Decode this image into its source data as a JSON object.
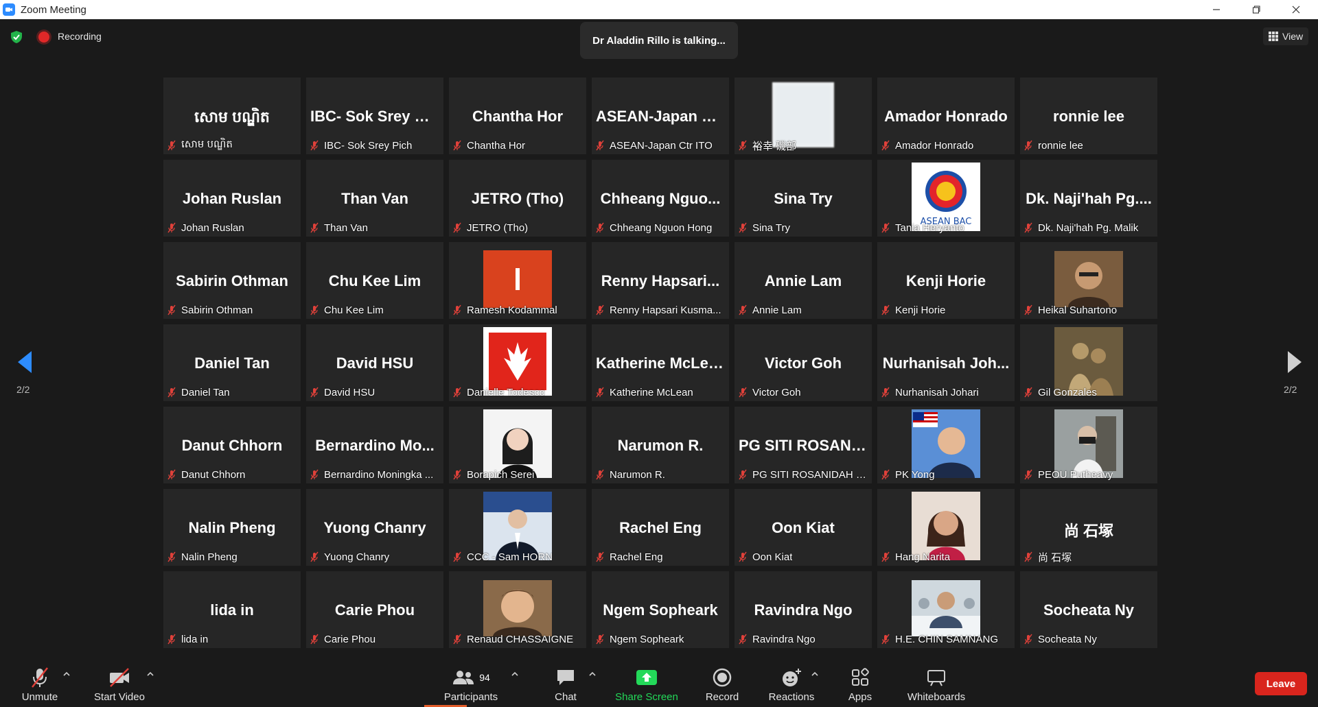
{
  "window": {
    "title": "Zoom Meeting"
  },
  "topbar": {
    "recording_label": "Recording",
    "talking_text": "Dr Aladdin Rillo is talking...",
    "view_label": "View"
  },
  "pager": {
    "left": "2/2",
    "right": "2/2"
  },
  "participants": [
    {
      "big": "សោម បណ្ឌិត",
      "label": "សោម បណ្ឌិត",
      "pic": ""
    },
    {
      "big": "IBC- Sok Srey Pi...",
      "label": "IBC- Sok Srey Pich",
      "pic": ""
    },
    {
      "big": "Chantha Hor",
      "label": "Chantha Hor",
      "pic": ""
    },
    {
      "big": "ASEAN-Japan C...",
      "label": "ASEAN-Japan Ctr ITO",
      "pic": ""
    },
    {
      "big": "",
      "label": "裕幸 磯部",
      "pic": "blur"
    },
    {
      "big": "Amador Honrado",
      "label": "Amador Honrado",
      "pic": ""
    },
    {
      "big": "ronnie lee",
      "label": "ronnie lee",
      "pic": ""
    },
    {
      "big": "Johan Ruslan",
      "label": "Johan Ruslan",
      "pic": ""
    },
    {
      "big": "Than Van",
      "label": "Than Van",
      "pic": ""
    },
    {
      "big": "JETRO (Tho)",
      "label": "JETRO (Tho)",
      "pic": ""
    },
    {
      "big": "Chheang Nguo...",
      "label": "Chheang Nguon Hong",
      "pic": ""
    },
    {
      "big": "Sina Try",
      "label": "Sina Try",
      "pic": ""
    },
    {
      "big": "",
      "label": "Tania Heryanto",
      "pic": "asean"
    },
    {
      "big": "Dk. Naji'hah Pg....",
      "label": "Dk. Naji'hah Pg. Malik",
      "pic": ""
    },
    {
      "big": "Sabirin Othman",
      "label": "Sabirin Othman",
      "pic": ""
    },
    {
      "big": "Chu Kee Lim",
      "label": "Chu Kee Lim",
      "pic": ""
    },
    {
      "big": "",
      "label": "Ramesh Kodammal",
      "pic": "orange"
    },
    {
      "big": "Renny Hapsari...",
      "label": "Renny Hapsari Kusma...",
      "pic": ""
    },
    {
      "big": "Annie Lam",
      "label": "Annie Lam",
      "pic": ""
    },
    {
      "big": "Kenji Horie",
      "label": "Kenji Horie",
      "pic": ""
    },
    {
      "big": "",
      "label": "Heikal Suhartono",
      "pic": "face-brown"
    },
    {
      "big": "Daniel Tan",
      "label": "Daniel Tan",
      "pic": ""
    },
    {
      "big": "David HSU",
      "label": "David HSU",
      "pic": ""
    },
    {
      "big": "",
      "label": "Danielle Todesco",
      "pic": "redlogo"
    },
    {
      "big": "Katherine McLean",
      "label": "Katherine McLean",
      "pic": ""
    },
    {
      "big": "Victor Goh",
      "label": "Victor Goh",
      "pic": ""
    },
    {
      "big": "Nurhanisah Joh...",
      "label": "Nurhanisah Johari",
      "pic": ""
    },
    {
      "big": "",
      "label": "Gil Gonzales",
      "pic": "statue"
    },
    {
      "big": "Danut Chhorn",
      "label": "Danut Chhorn",
      "pic": ""
    },
    {
      "big": "Bernardino Mo...",
      "label": "Bernardino Moningka ...",
      "pic": ""
    },
    {
      "big": "",
      "label": "Borapich Serei",
      "pic": "face-light"
    },
    {
      "big": "Narumon R.",
      "label": "Narumon R.",
      "pic": ""
    },
    {
      "big": "PG SITI ROSANI...",
      "label": "PG SITI ROSANIDAH BI...",
      "pic": ""
    },
    {
      "big": "",
      "label": "PK Yong",
      "pic": "face-flag"
    },
    {
      "big": "",
      "label": "PEOU Putheavy",
      "pic": "face-gray"
    },
    {
      "big": "Nalin Pheng",
      "label": "Nalin Pheng",
      "pic": ""
    },
    {
      "big": "Yuong Chanry",
      "label": "Yuong Chanry",
      "pic": ""
    },
    {
      "big": "",
      "label": "CCC - Sam HORN",
      "pic": "suit"
    },
    {
      "big": "Rachel Eng",
      "label": "Rachel Eng",
      "pic": ""
    },
    {
      "big": "Oon Kiat",
      "label": "Oon Kiat",
      "pic": ""
    },
    {
      "big": "",
      "label": "Hang Narita",
      "pic": "face-warm"
    },
    {
      "big": "尚 石塚",
      "label": "尚 石塚",
      "pic": ""
    },
    {
      "big": "lida in",
      "label": "lida in",
      "pic": ""
    },
    {
      "big": "Carie Phou",
      "label": "Carie Phou",
      "pic": ""
    },
    {
      "big": "",
      "label": "Renaud CHASSAIGNE",
      "pic": "face-tan"
    },
    {
      "big": "Ngem Sopheark",
      "label": "Ngem Sopheark",
      "pic": ""
    },
    {
      "big": "Ravindra Ngo",
      "label": "Ravindra Ngo",
      "pic": ""
    },
    {
      "big": "",
      "label": "H.E. CHIN SAMNANG",
      "pic": "office"
    },
    {
      "big": "Socheata Ny",
      "label": "Socheata Ny",
      "pic": ""
    }
  ],
  "toolbar": {
    "unmute": "Unmute",
    "start_video": "Start Video",
    "participants": "Participants",
    "participants_count": "94",
    "chat": "Chat",
    "share_screen": "Share Screen",
    "record": "Record",
    "reactions": "Reactions",
    "apps": "Apps",
    "whiteboards": "Whiteboards",
    "leave": "Leave"
  },
  "colors": {
    "accent_blue": "#2d8cff",
    "share_green": "#23d959",
    "leave_red": "#d9251d",
    "mute_red": "#e0413a"
  }
}
